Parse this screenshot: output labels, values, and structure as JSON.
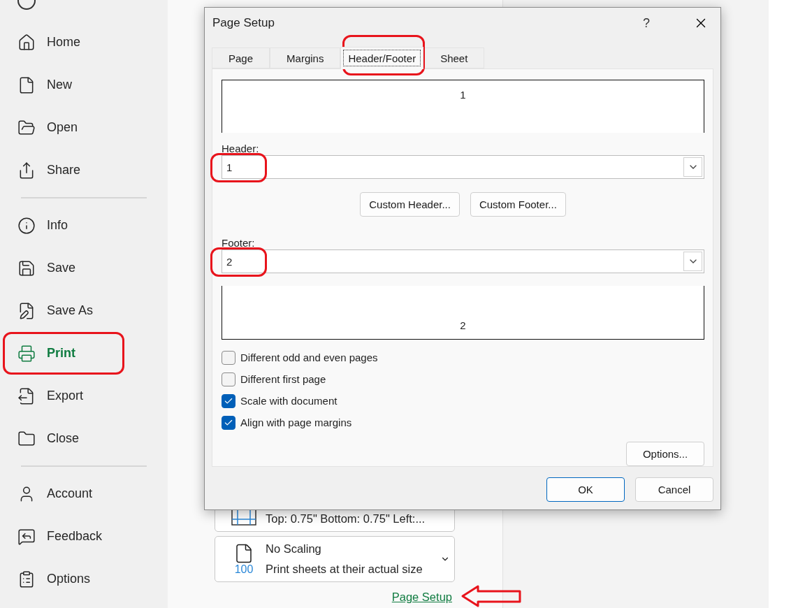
{
  "backstage_nav": {
    "items": [
      {
        "label": "Home",
        "selected": false,
        "highlighted": false
      },
      {
        "label": "New",
        "selected": false,
        "highlighted": false
      },
      {
        "label": "Open",
        "selected": false,
        "highlighted": false
      },
      {
        "label": "Share",
        "selected": false,
        "highlighted": false
      },
      {
        "label": "Info",
        "selected": false,
        "highlighted": false
      },
      {
        "label": "Save",
        "selected": false,
        "highlighted": false
      },
      {
        "label": "Save As",
        "selected": false,
        "highlighted": false
      },
      {
        "label": "Print",
        "selected": true,
        "highlighted": true
      },
      {
        "label": "Export",
        "selected": false,
        "highlighted": false
      },
      {
        "label": "Close",
        "selected": false,
        "highlighted": false
      },
      {
        "label": "Account",
        "selected": false,
        "highlighted": false
      },
      {
        "label": "Feedback",
        "selected": false,
        "highlighted": false
      },
      {
        "label": "Options",
        "selected": false,
        "highlighted": false
      }
    ]
  },
  "print_settings": [
    {
      "kind": "margins",
      "detail": "Top: 0.75\" Bottom: 0.75\" Left:..."
    },
    {
      "kind": "scaling",
      "title": "No Scaling",
      "detail": "Print sheets at their actual size",
      "icon_text": "100"
    }
  ],
  "page_setup_link": {
    "label": "Page Setup",
    "highlighted": true
  },
  "dialog": {
    "title": "Page Setup",
    "help": "?",
    "tabs": [
      {
        "label": "Page",
        "selected": false,
        "highlighted": false
      },
      {
        "label": "Margins",
        "selected": false,
        "highlighted": false
      },
      {
        "label": "Header/Footer",
        "selected": true,
        "highlighted": true
      },
      {
        "label": "Sheet",
        "selected": false,
        "highlighted": false
      }
    ],
    "header_preview": "1",
    "header": {
      "label": "Header:",
      "value": "1",
      "highlighted": true
    },
    "custom_buttons": [
      {
        "label": "Custom Header..."
      },
      {
        "label": "Custom Footer..."
      }
    ],
    "footer": {
      "label": "Footer:",
      "value": "2",
      "highlighted": true
    },
    "footer_preview": "2",
    "options": [
      {
        "label": "Different odd and even pages",
        "checked": false
      },
      {
        "label": "Different first page",
        "checked": false
      },
      {
        "label": "Scale with document",
        "checked": true
      },
      {
        "label": "Align with page margins",
        "checked": true
      }
    ],
    "options_button": {
      "label": "Options..."
    },
    "buttons": [
      {
        "label": "OK",
        "default": true
      },
      {
        "label": "Cancel",
        "default": false
      }
    ]
  }
}
